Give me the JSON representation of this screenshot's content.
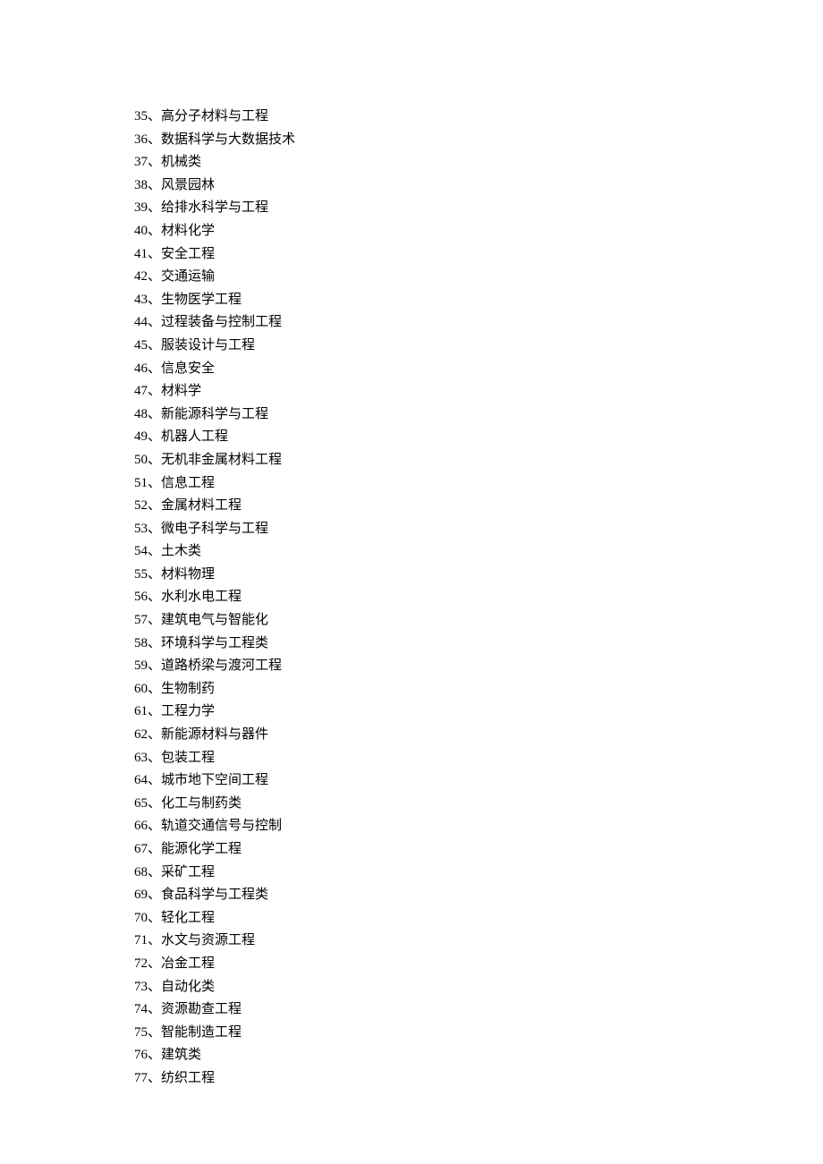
{
  "separator": "、",
  "items": [
    {
      "num": "35",
      "text": "高分子材料与工程"
    },
    {
      "num": "36",
      "text": "数据科学与大数据技术"
    },
    {
      "num": "37",
      "text": "机械类"
    },
    {
      "num": "38",
      "text": "风景园林"
    },
    {
      "num": "39",
      "text": "给排水科学与工程"
    },
    {
      "num": "40",
      "text": "材料化学"
    },
    {
      "num": "41",
      "text": "安全工程"
    },
    {
      "num": "42",
      "text": "交通运输"
    },
    {
      "num": "43",
      "text": "生物医学工程"
    },
    {
      "num": "44",
      "text": "过程装备与控制工程"
    },
    {
      "num": "45",
      "text": "服装设计与工程"
    },
    {
      "num": "46",
      "text": "信息安全"
    },
    {
      "num": "47",
      "text": "材料学"
    },
    {
      "num": "48",
      "text": "新能源科学与工程"
    },
    {
      "num": "49",
      "text": "机器人工程"
    },
    {
      "num": "50",
      "text": "无机非金属材料工程"
    },
    {
      "num": "51",
      "text": "信息工程"
    },
    {
      "num": "52",
      "text": "金属材料工程"
    },
    {
      "num": "53",
      "text": "微电子科学与工程"
    },
    {
      "num": "54",
      "text": "土木类"
    },
    {
      "num": "55",
      "text": "材料物理"
    },
    {
      "num": "56",
      "text": "水利水电工程"
    },
    {
      "num": "57",
      "text": "建筑电气与智能化"
    },
    {
      "num": "58",
      "text": "环境科学与工程类"
    },
    {
      "num": "59",
      "text": "道路桥梁与渡河工程"
    },
    {
      "num": "60",
      "text": "生物制药"
    },
    {
      "num": "61",
      "text": "工程力学"
    },
    {
      "num": "62",
      "text": "新能源材料与器件"
    },
    {
      "num": "63",
      "text": "包装工程"
    },
    {
      "num": "64",
      "text": "城市地下空间工程"
    },
    {
      "num": "65",
      "text": "化工与制药类"
    },
    {
      "num": "66",
      "text": "轨道交通信号与控制"
    },
    {
      "num": "67",
      "text": "能源化学工程"
    },
    {
      "num": "68",
      "text": "采矿工程"
    },
    {
      "num": "69",
      "text": "食品科学与工程类"
    },
    {
      "num": "70",
      "text": "轻化工程"
    },
    {
      "num": "71",
      "text": "水文与资源工程"
    },
    {
      "num": "72",
      "text": "冶金工程"
    },
    {
      "num": "73",
      "text": "自动化类"
    },
    {
      "num": "74",
      "text": "资源勘查工程"
    },
    {
      "num": "75",
      "text": "智能制造工程"
    },
    {
      "num": "76",
      "text": "建筑类"
    },
    {
      "num": "77",
      "text": "纺织工程"
    }
  ]
}
